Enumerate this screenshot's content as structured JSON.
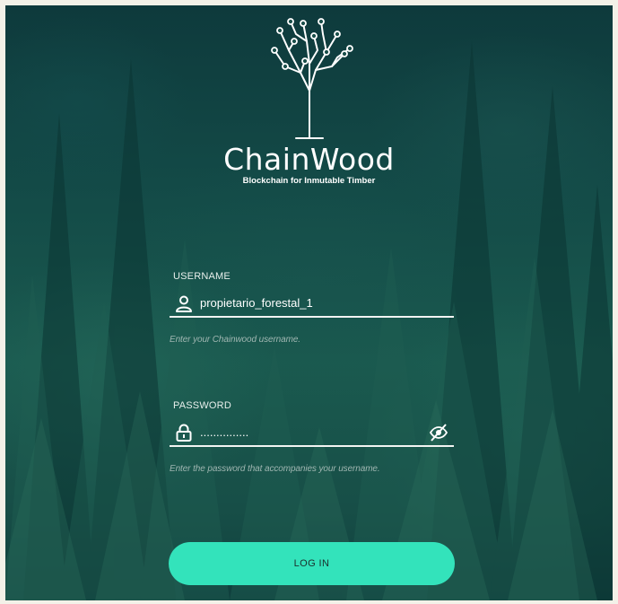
{
  "brand": {
    "name": "ChainWood",
    "tagline": "Blockchain for Inmutable Timber"
  },
  "username": {
    "label": "USERNAME",
    "value": "propietario_forestal_1",
    "hint": "Enter your Chainwood username."
  },
  "password": {
    "label": "PASSWORD",
    "value": "...............",
    "hint": "Enter the password that accompanies your username."
  },
  "login": {
    "label": "LOG IN"
  },
  "colors": {
    "accent": "#33e3bb",
    "background": "#134a47",
    "text": "#ffffff"
  },
  "icons": {
    "logo": "circuit-tree-icon",
    "username": "user-icon",
    "password": "lock-icon",
    "toggle": "eye-slash-icon"
  }
}
